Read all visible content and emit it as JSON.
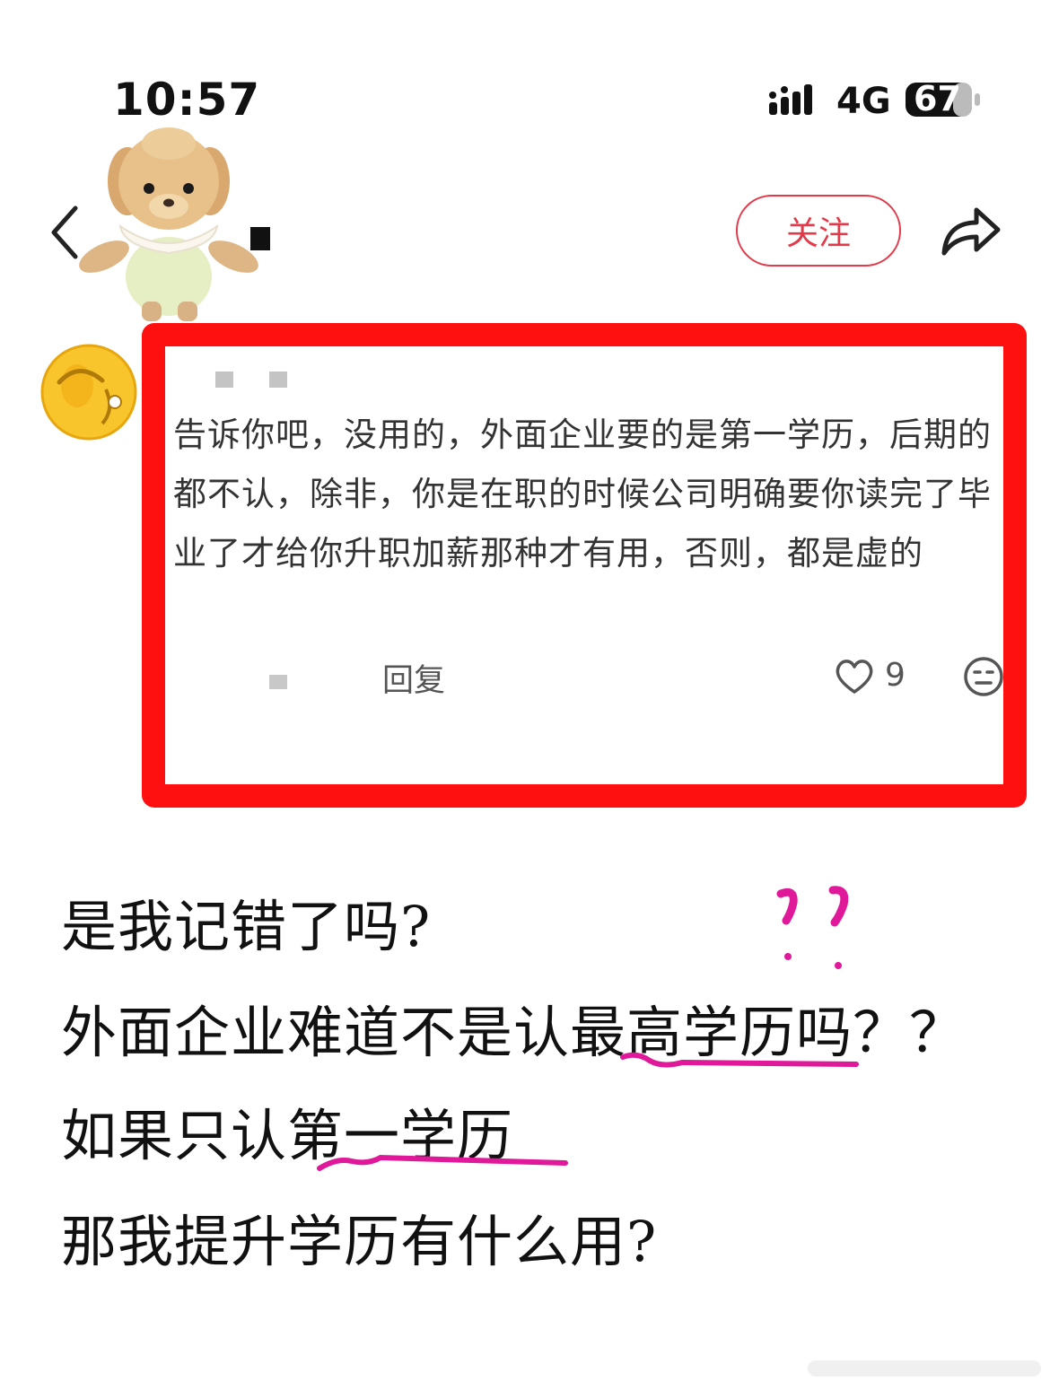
{
  "status_bar": {
    "time": "10:57",
    "network": "4G",
    "battery": "67"
  },
  "header": {
    "follow_label": "关注",
    "icons": [
      "chevron-left-icon",
      "share-icon"
    ]
  },
  "comment": {
    "text": "告诉你吧，没用的，外面企业要的是第一学历，后期的都不认，除非，你是在职的时候公司明确要你读完了毕业了才给你升职加薪那种才有用，否则，都是虚的",
    "reply_label": "回复",
    "like_count": "9",
    "highlight_color": "#ff1010"
  },
  "caption": {
    "line1": "是我记错了吗?",
    "line2": "外面企业难道不是认最高学历吗？？",
    "line3": "如果只认第一学历",
    "line4": "那我提升学历有什么用?"
  },
  "colors": {
    "accent": "#e23a4a",
    "annotation": "#e0189a"
  }
}
